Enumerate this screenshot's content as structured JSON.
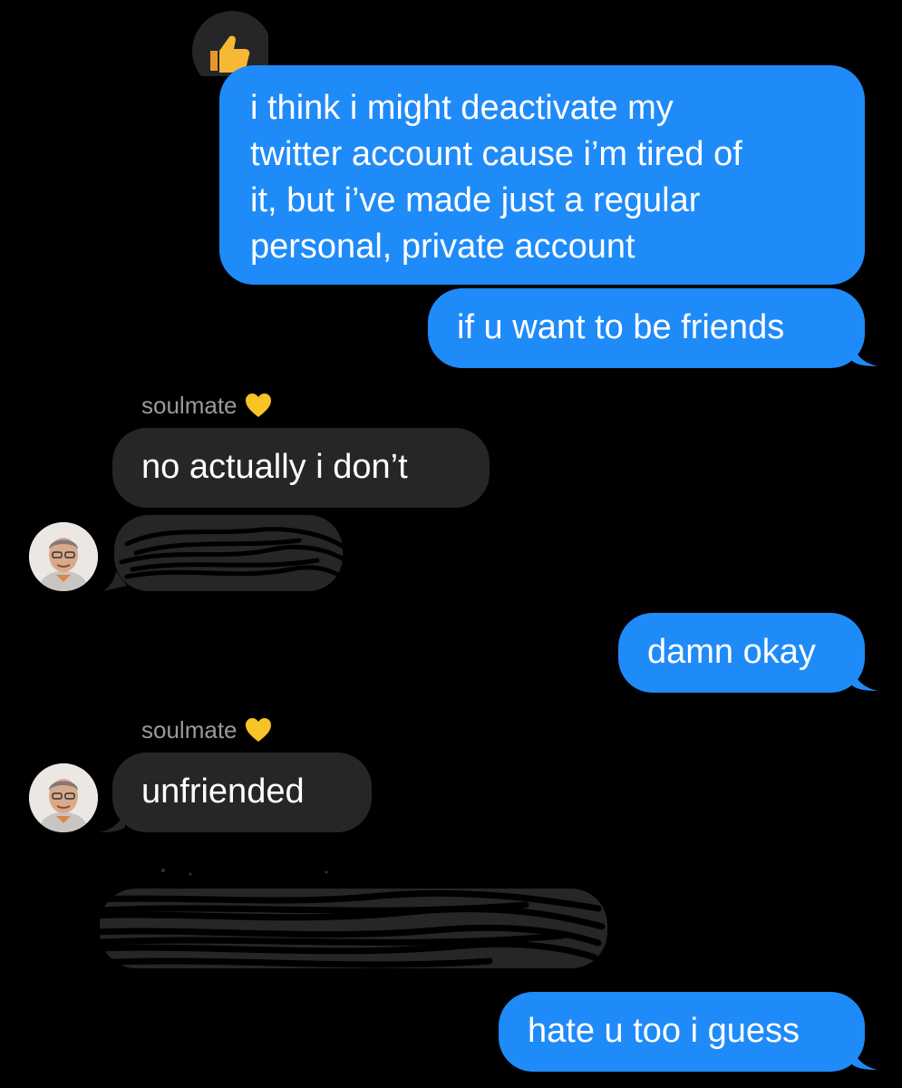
{
  "conversation": {
    "messages": [
      {
        "id": "m1",
        "direction": "sent",
        "lines": [
          "i think i might deactivate my",
          "twitter account cause i’m tired of",
          "it, but i’ve made just a regular",
          "personal, private account"
        ],
        "reaction": "thumbs-up-icon"
      },
      {
        "id": "m2",
        "direction": "sent",
        "text": "if u want to be friends"
      },
      {
        "id": "m3",
        "direction": "received",
        "sender": "soulmate",
        "text": "no actually i don’t"
      },
      {
        "id": "m4",
        "direction": "received",
        "text": "",
        "redacted": true
      },
      {
        "id": "m5",
        "direction": "sent",
        "text": "damn okay"
      },
      {
        "id": "m6",
        "direction": "received",
        "sender": "soulmate",
        "text": "unfriended"
      },
      {
        "id": "m7",
        "direction": "received",
        "text": "",
        "redacted": true
      },
      {
        "id": "m8",
        "direction": "sent",
        "text": "hate u too i guess"
      }
    ],
    "sender_label": "soulmate",
    "sender_emoji": "yellow-heart-icon"
  },
  "colors": {
    "background": "#000000",
    "sent_bubble": "#1f8bf8",
    "received_bubble": "#262628",
    "sender_name": "#9a9a9e",
    "heart": "#f7c325"
  }
}
